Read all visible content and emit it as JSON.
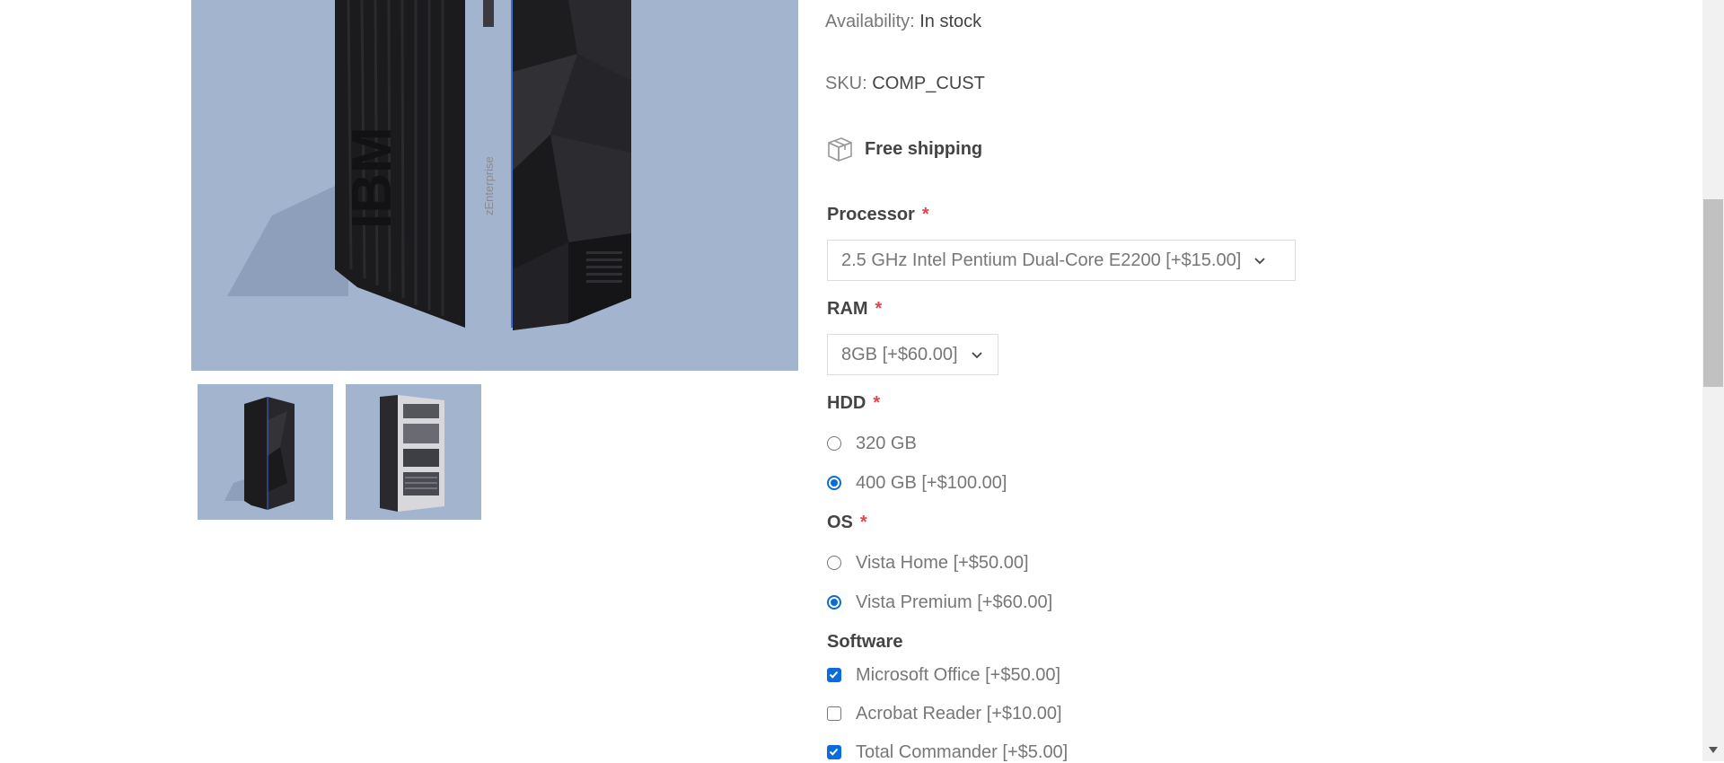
{
  "gallery": {
    "main_image_text": {
      "brand": "IBM",
      "model": "zEnterprise"
    }
  },
  "details": {
    "availability": {
      "label": "Availability:",
      "value": "In stock"
    },
    "sku": {
      "label": "SKU:",
      "value": "COMP_CUST"
    },
    "shipping": {
      "label": "Free shipping",
      "icon": "package-box-icon"
    },
    "required_mark": "*",
    "processor": {
      "label": "Processor",
      "selected": "2.5 GHz Intel Pentium Dual-Core E2200 [+$15.00]"
    },
    "ram": {
      "label": "RAM",
      "selected": "8GB [+$60.00]"
    },
    "hdd": {
      "label": "HDD",
      "options": [
        {
          "label": "320 GB",
          "checked": false
        },
        {
          "label": "400 GB [+$100.00]",
          "checked": true
        }
      ]
    },
    "os": {
      "label": "OS",
      "options": [
        {
          "label": "Vista Home [+$50.00]",
          "checked": false
        },
        {
          "label": "Vista Premium [+$60.00]",
          "checked": true
        }
      ]
    },
    "software": {
      "label": "Software",
      "options": [
        {
          "label": "Microsoft Office [+$50.00]",
          "checked": true
        },
        {
          "label": "Acrobat Reader [+$10.00]",
          "checked": false
        },
        {
          "label": "Total Commander [+$5.00]",
          "checked": true
        }
      ]
    }
  },
  "colors": {
    "image_background": "#a3b4cf",
    "accent": "#0b6bdb",
    "required": "#e4434b"
  }
}
